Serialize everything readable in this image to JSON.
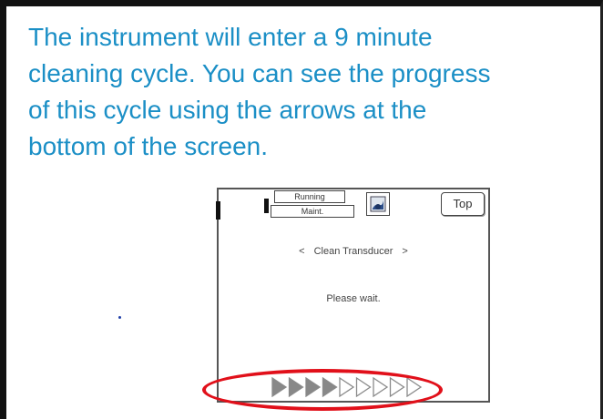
{
  "slide": {
    "caption": "The instrument will enter a 9 minute\ncleaning cycle. You can see the progress\nof this cycle using the arrows at the\nbottom of the screen."
  },
  "instrument_screen": {
    "tabs": {
      "running": "Running",
      "maint": "Maint."
    },
    "icon": "sample-icon",
    "top_button": "Top",
    "nav": {
      "prev": "<",
      "title": "Clean Transducer",
      "next": ">"
    },
    "status": "Please wait.",
    "progress": {
      "filled": 4,
      "total": 9,
      "filled_color": "#888888"
    }
  },
  "highlight_color": "#e1101a"
}
